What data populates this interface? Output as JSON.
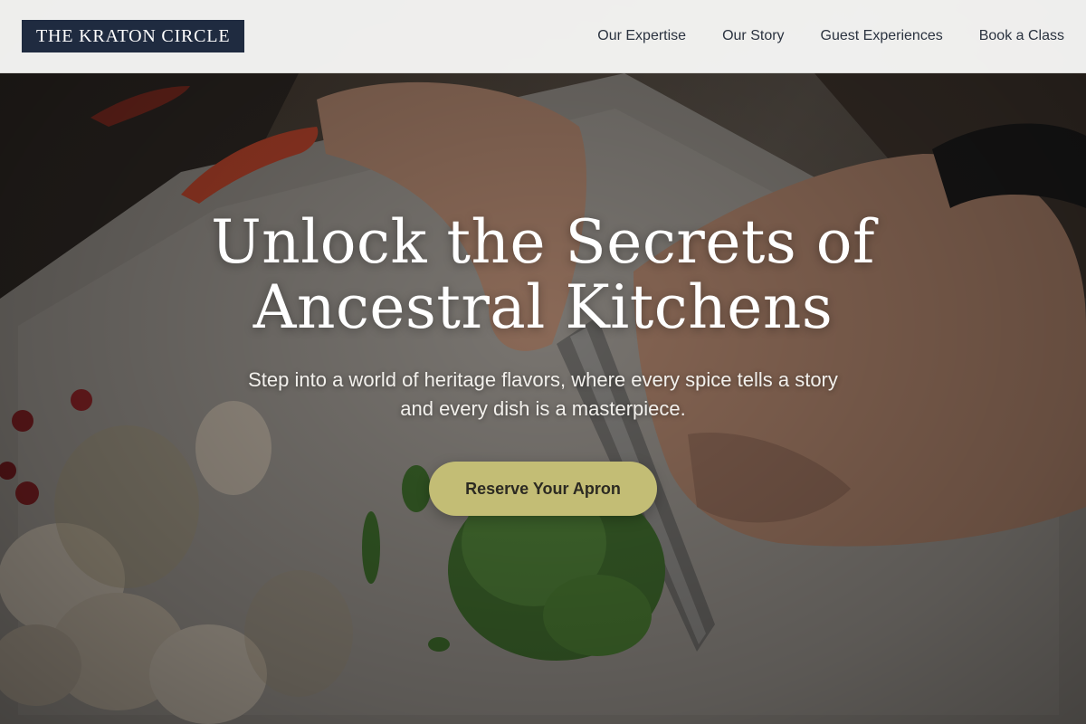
{
  "brand": {
    "logo_text": "THE KRATON CIRCLE"
  },
  "nav": {
    "items": [
      {
        "label": "Our Expertise"
      },
      {
        "label": "Our Story"
      },
      {
        "label": "Guest Experiences"
      },
      {
        "label": "Book a Class"
      }
    ]
  },
  "hero": {
    "title_line1": "Unlock the Secrets of",
    "title_line2": "Ancestral Kitchens",
    "subtitle": "Step into a world of heritage flavors, where every spice tells a story and every dish is a masterpiece.",
    "cta_label": "Reserve Your Apron",
    "image_description": "Hands chopping okra on a cutting board with mushrooms, chili peppers and sesame seeds"
  },
  "colors": {
    "logo_background": "#1f2b40",
    "cta_background": "#c3bd75",
    "header_background": "#f7f7f6"
  }
}
